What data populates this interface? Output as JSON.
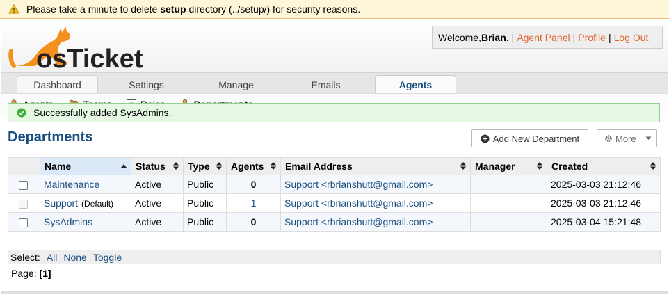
{
  "warning": {
    "before": "Please take a minute to delete ",
    "bold": "setup",
    "after": " directory (../setup/) for security reasons.",
    "icon": "warning-icon"
  },
  "logo": {
    "text": "osTicket",
    "color": "#f4901e"
  },
  "welcome": {
    "greeting": "Welcome, ",
    "user": "Brian",
    "after_user": ".",
    "agent_panel": "Agent Panel",
    "profile": "Profile",
    "logout": "Log Out"
  },
  "tabs": [
    "Dashboard",
    "Settings",
    "Manage",
    "Emails",
    "Agents"
  ],
  "active_tab": "Agents",
  "subnav": [
    "Agents",
    "Teams",
    "Roles",
    "Departments"
  ],
  "active_subnav": "Departments",
  "success_message": "Successfully added SysAdmins.",
  "page_title": "Departments",
  "buttons": {
    "add": "Add New Department",
    "more": "More"
  },
  "table": {
    "columns": [
      "Name",
      "Status",
      "Type",
      "Agents",
      "Email Address",
      "Manager",
      "Created"
    ],
    "rows": [
      {
        "name": "Maintenance",
        "tag": "",
        "status": "Active",
        "type": "Public",
        "agents": "0",
        "email": "Support <rbrianshutt@gmail.com>",
        "manager": "",
        "created": "2025-03-03 21:12:46"
      },
      {
        "name": "Support",
        "tag": "(Default)",
        "status": "Active",
        "type": "Public",
        "agents": "1",
        "email": "Support <rbrianshutt@gmail.com>",
        "manager": "",
        "created": "2025-03-03 21:12:46"
      },
      {
        "name": "SysAdmins",
        "tag": "",
        "status": "Active",
        "type": "Public",
        "agents": "0",
        "email": "Support <rbrianshutt@gmail.com>",
        "manager": "",
        "created": "2025-03-04 15:21:48"
      }
    ]
  },
  "select": {
    "label": "Select:",
    "all": "All",
    "none": "None",
    "toggle": "Toggle"
  },
  "pager": {
    "label": "Page:",
    "current": "[1]"
  },
  "colors": {
    "accent": "#184e81",
    "link_orange": "#e0632b",
    "success_bg": "#e6f7e4",
    "warning_bg": "#fdf6d8"
  }
}
